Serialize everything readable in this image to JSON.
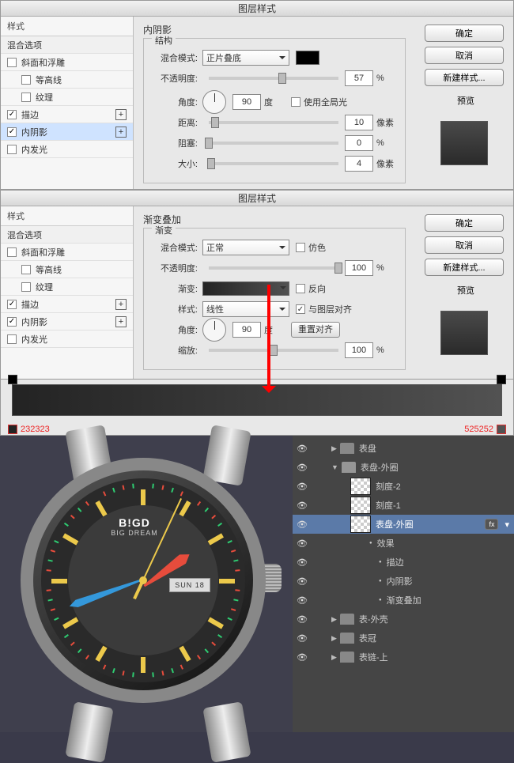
{
  "dialog1": {
    "title": "图层样式",
    "sidebar": {
      "head": "样式",
      "blend": "混合选项",
      "items": [
        {
          "label": "斜面和浮雕",
          "checked": false,
          "plus": false
        },
        {
          "label": "等高线",
          "checked": false,
          "plus": false,
          "indent": true
        },
        {
          "label": "纹理",
          "checked": false,
          "plus": false,
          "indent": true
        },
        {
          "label": "描边",
          "checked": true,
          "plus": true
        },
        {
          "label": "内阴影",
          "checked": true,
          "plus": true,
          "active": true
        },
        {
          "label": "内发光",
          "checked": false,
          "plus": false
        }
      ]
    },
    "section": "内阴影",
    "group": "结构",
    "blendmode_lbl": "混合模式:",
    "blendmode_val": "正片叠底",
    "opacity_lbl": "不透明度:",
    "opacity_val": "57",
    "opacity_suf": "%",
    "angle_lbl": "角度:",
    "angle_val": "90",
    "angle_suf": "度",
    "global_lbl": "使用全局光",
    "dist_lbl": "距离:",
    "dist_val": "10",
    "dist_suf": "像素",
    "choke_lbl": "阻塞:",
    "choke_val": "0",
    "choke_suf": "%",
    "size_lbl": "大小:",
    "size_val": "4",
    "size_suf": "像素",
    "buttons": {
      "ok": "确定",
      "cancel": "取消",
      "new": "新建样式...",
      "preview": "预览"
    }
  },
  "dialog2": {
    "title": "图层样式",
    "sidebar": {
      "head": "样式",
      "blend": "混合选项",
      "items": [
        {
          "label": "斜面和浮雕",
          "checked": false
        },
        {
          "label": "等高线",
          "checked": false,
          "indent": true
        },
        {
          "label": "纹理",
          "checked": false,
          "indent": true
        },
        {
          "label": "描边",
          "checked": true,
          "plus": true
        },
        {
          "label": "内阴影",
          "checked": true,
          "plus": true
        },
        {
          "label": "内发光",
          "checked": false
        }
      ]
    },
    "section": "渐变叠加",
    "group": "渐变",
    "blendmode_lbl": "混合模式:",
    "blendmode_val": "正常",
    "dither_lbl": "仿色",
    "opacity_lbl": "不透明度:",
    "opacity_val": "100",
    "opacity_suf": "%",
    "grad_lbl": "渐变:",
    "reverse_lbl": "反向",
    "style_lbl": "样式:",
    "style_val": "线性",
    "align_lbl": "与图层对齐",
    "angle_lbl": "角度:",
    "angle_val": "90",
    "angle_suf": "度",
    "reset": "重置对齐",
    "scale_lbl": "缩放:",
    "scale_val": "100",
    "scale_suf": "%",
    "buttons": {
      "ok": "确定",
      "cancel": "取消",
      "new": "新建样式...",
      "preview": "预览"
    }
  },
  "gradient": {
    "left": "232323",
    "right": "525252"
  },
  "watch": {
    "logo": "B!GD",
    "sub": "BIG DREAM",
    "date": "SUN 18"
  },
  "layers": {
    "rows": [
      {
        "eye": true,
        "type": "folder",
        "label": "表盘",
        "ind": 1,
        "open": false,
        "tw": "▶"
      },
      {
        "eye": true,
        "type": "folder",
        "label": "表盘-外圈",
        "ind": 1,
        "open": true,
        "tw": "▼"
      },
      {
        "eye": true,
        "type": "layer",
        "label": "刻度-2",
        "ind": 3
      },
      {
        "eye": true,
        "type": "layer",
        "label": "刻度-1",
        "ind": 3
      },
      {
        "eye": true,
        "type": "layer",
        "label": "表盘-外圈",
        "ind": 3,
        "sel": true,
        "fx": "fx"
      },
      {
        "eye": true,
        "type": "fx",
        "label": "效果",
        "ind": 5
      },
      {
        "eye": true,
        "type": "fx",
        "label": "描边",
        "ind": 6
      },
      {
        "eye": true,
        "type": "fx",
        "label": "内阴影",
        "ind": 6
      },
      {
        "eye": true,
        "type": "fx",
        "label": "渐变叠加",
        "ind": 6
      },
      {
        "eye": true,
        "type": "folder",
        "label": "表-外壳",
        "ind": 1,
        "tw": "▶"
      },
      {
        "eye": true,
        "type": "folder",
        "label": "表冠",
        "ind": 1,
        "tw": "▶"
      },
      {
        "eye": true,
        "type": "folder",
        "label": "表链-上",
        "ind": 1,
        "tw": "▶"
      }
    ]
  }
}
